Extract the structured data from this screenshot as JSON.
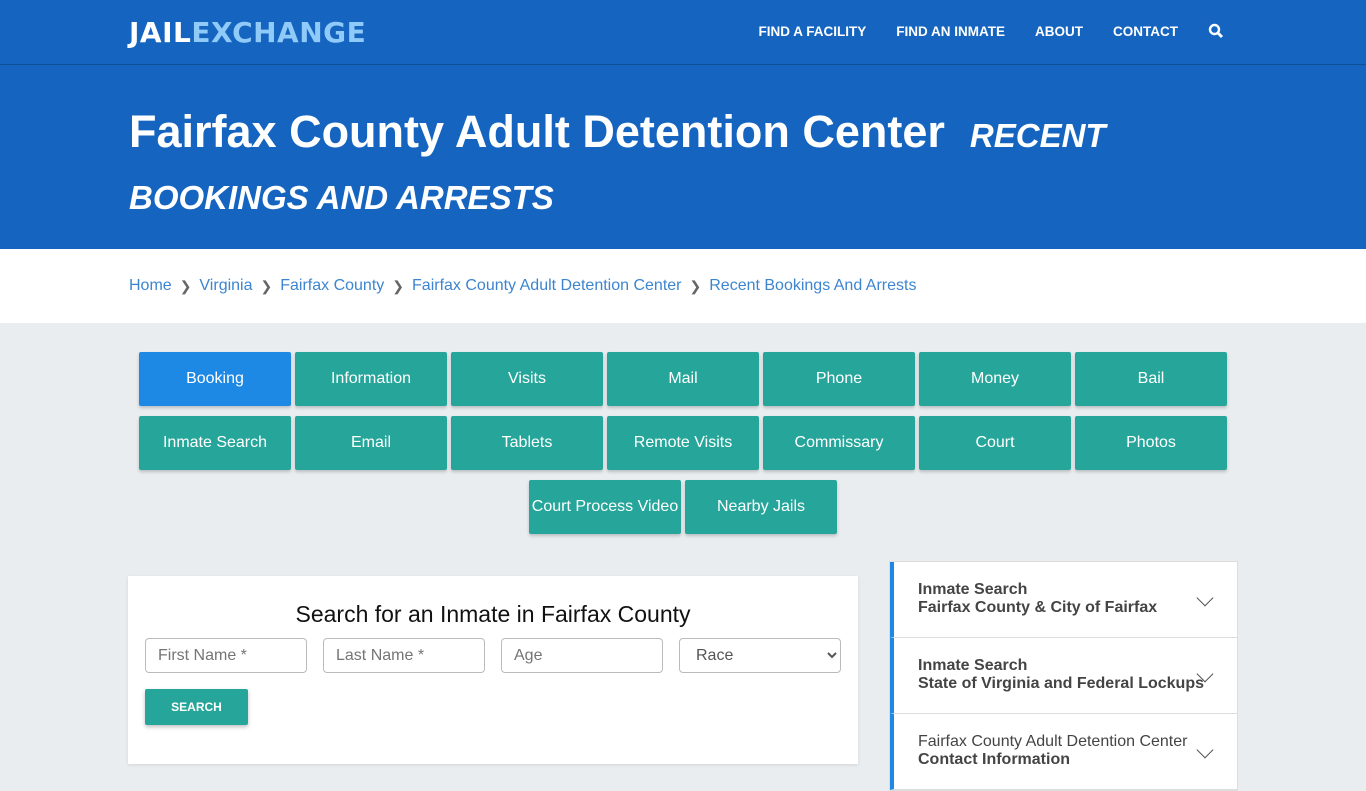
{
  "nav": {
    "logo_a": "JAIL",
    "logo_b": "EXCHANGE",
    "items": [
      "FIND A FACILITY",
      "FIND AN INMATE",
      "ABOUT",
      "CONTACT"
    ]
  },
  "hero": {
    "title": "Fairfax County Adult Detention Center",
    "subtitle": "RECENT BOOKINGS AND ARRESTS"
  },
  "breadcrumb": [
    "Home",
    "Virginia",
    "Fairfax County",
    "Fairfax County Adult Detention Center",
    "Recent Bookings And Arrests"
  ],
  "tiles": [
    "Booking",
    "Information",
    "Visits",
    "Mail",
    "Phone",
    "Money",
    "Bail",
    "Inmate Search",
    "Email",
    "Tablets",
    "Remote Visits",
    "Commissary",
    "Court",
    "Photos",
    "Court Process Video",
    "Nearby Jails"
  ],
  "search": {
    "title": "Search for an Inmate in Fairfax County",
    "first": "First Name *",
    "last": "Last Name *",
    "age": "Age",
    "race": "Race",
    "button": "SEARCH"
  },
  "sidebar": [
    {
      "line1": "Inmate Search",
      "line2": "Fairfax County & City of Fairfax"
    },
    {
      "line1": "Inmate Search",
      "line2": "State of Virginia and Federal Lockups"
    },
    {
      "line1": "Fairfax County Adult Detention Center",
      "line2": "Contact Information"
    }
  ]
}
